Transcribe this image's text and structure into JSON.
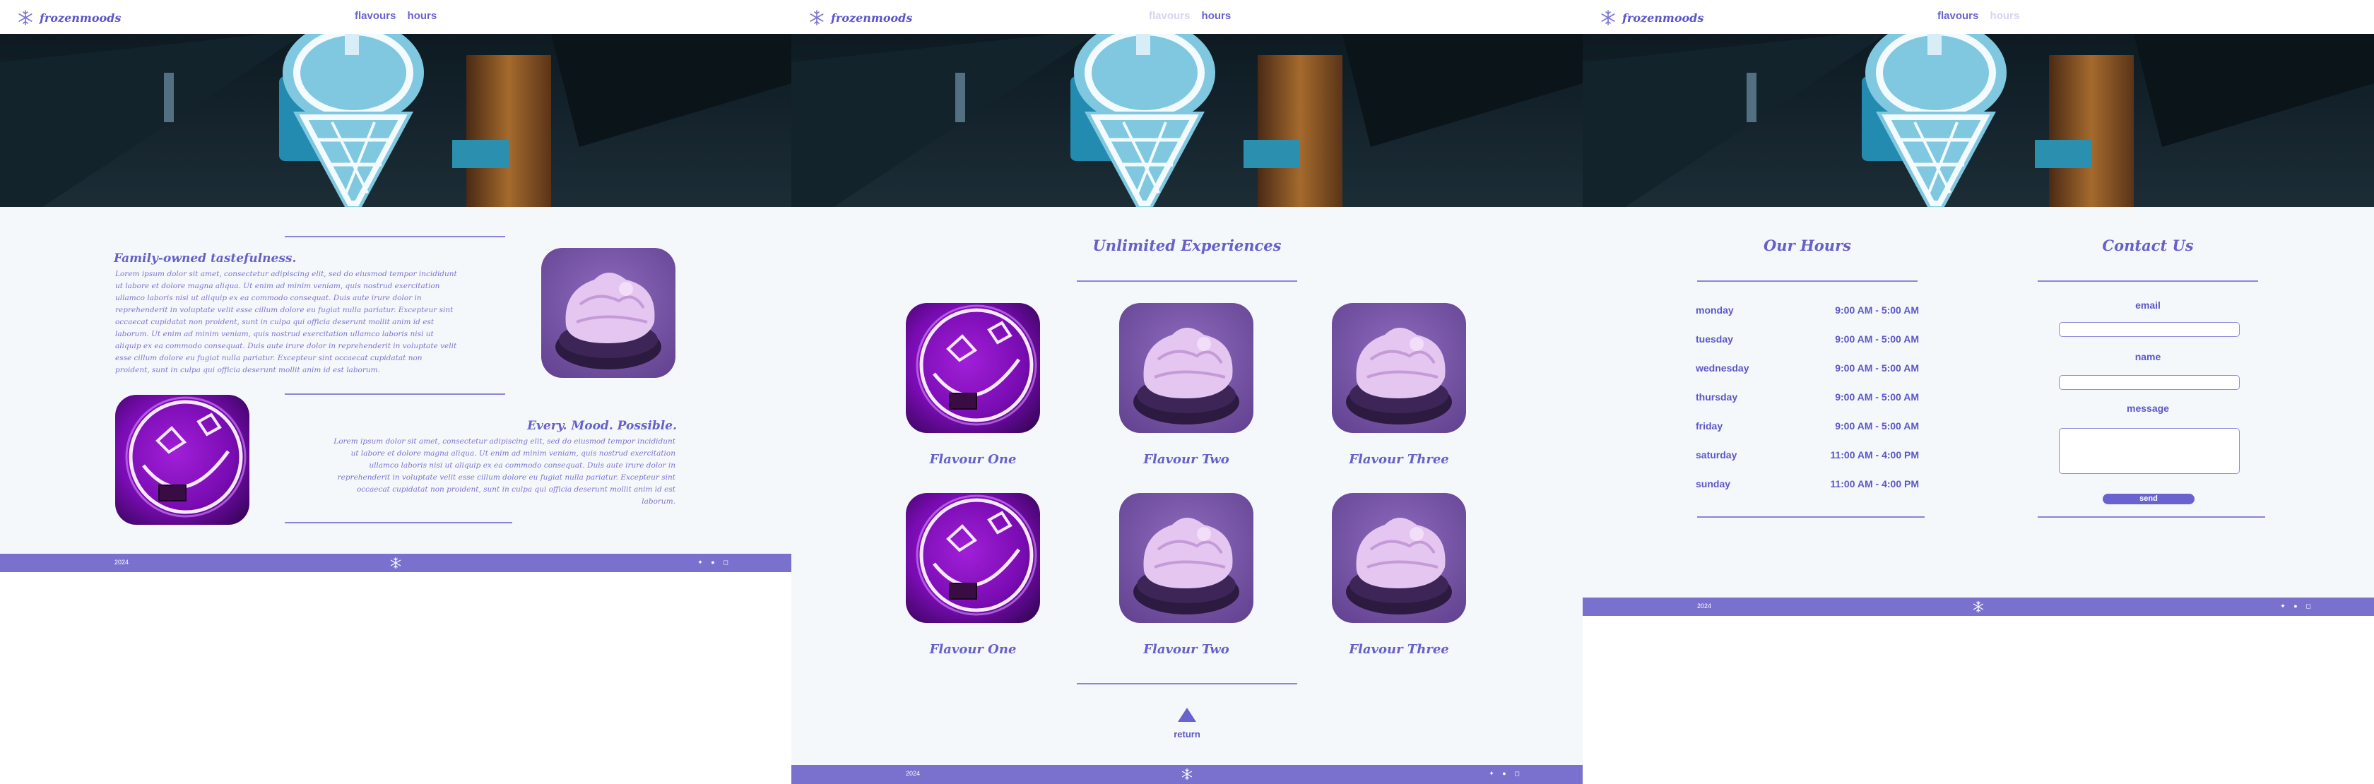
{
  "brand": {
    "name": "frozenmoods"
  },
  "nav": {
    "flavours": "flavours",
    "hours": "hours"
  },
  "about": {
    "section1_title": "Family-owned tastefulness.",
    "section1_body": "Lorem ipsum dolor sit amet, consectetur adipiscing elit, sed do eiusmod tempor incididunt ut labore et dolore magna aliqua. Ut enim ad minim veniam, quis nostrud exercitation ullamco laboris nisi ut aliquip ex ea commodo consequat. Duis aute irure dolor in reprehenderit in voluptate velit esse cillum dolore eu fugiat nulla pariatur. Excepteur sint occaecat cupidatat non proident, sunt in culpa qui officia deserunt mollit anim id est laborum. Ut enim ad minim veniam, quis nostrud exercitation ullamco laboris nisi ut aliquip ex ea commodo consequat. Duis aute irure dolor in reprehenderit in voluptate velit esse cillum dolore eu fugiat nulla pariatur. Excepteur sint occaecat cupidatat non proident, sunt in culpa qui officia deserunt mollit anim id est laborum.",
    "section2_title": "Every. Mood. Possible.",
    "section2_body": "Lorem ipsum dolor sit amet, consectetur adipiscing elit, sed do eiusmod tempor incididunt ut labore et dolore magna aliqua. Ut enim ad minim veniam, quis nostrud exercitation ullamco laboris nisi ut aliquip ex ea commodo consequat. Duis aute irure dolor in reprehenderit in voluptate velit esse cillum dolore eu fugiat nulla pariatur. Excepteur sint occaecat cupidatat non proident, sunt in culpa qui officia deserunt mollit anim id est laborum."
  },
  "flavours": {
    "title": "Unlimited Experiences",
    "items": [
      {
        "label": "Flavour One",
        "image": "neon-smiley"
      },
      {
        "label": "Flavour Two",
        "image": "ice-cream-scoop"
      },
      {
        "label": "Flavour Three",
        "image": "ice-cream-scoop"
      },
      {
        "label": "Flavour One",
        "image": "neon-smiley"
      },
      {
        "label": "Flavour Two",
        "image": "ice-cream-scoop"
      },
      {
        "label": "Flavour Three",
        "image": "ice-cream-scoop"
      }
    ],
    "return_label": "return"
  },
  "hours": {
    "title": "Our Hours",
    "rows": [
      {
        "day": "monday",
        "time": "9:00 AM - 5:00 AM"
      },
      {
        "day": "tuesday",
        "time": "9:00 AM - 5:00 AM"
      },
      {
        "day": "wednesday",
        "time": "9:00 AM - 5:00 AM"
      },
      {
        "day": "thursday",
        "time": "9:00 AM - 5:00 AM"
      },
      {
        "day": "friday",
        "time": "9:00 AM - 5:00 AM"
      },
      {
        "day": "saturday",
        "time": "11:00 AM - 4:00 PM"
      },
      {
        "day": "sunday",
        "time": "11:00 AM - 4:00 PM"
      }
    ]
  },
  "contact": {
    "title": "Contact Us",
    "email_label": "email",
    "name_label": "name",
    "message_label": "message",
    "send_label": "send"
  },
  "footer": {
    "year": "2024"
  },
  "colors": {
    "accent": "#6a62cf",
    "background": "#f4f8fb",
    "footer": "#7a71cf"
  }
}
